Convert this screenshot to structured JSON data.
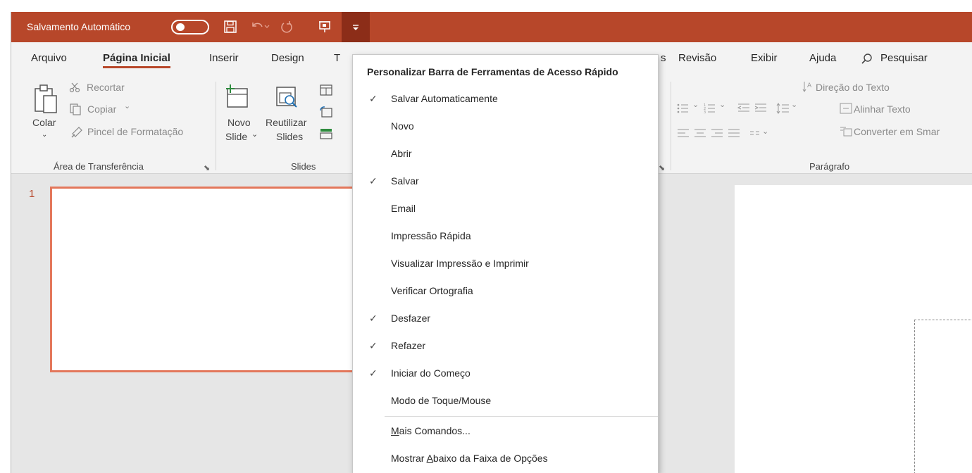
{
  "colors": {
    "brand": "#b7472a",
    "brand_dark": "#8c2d18",
    "thumb_border": "#e3775b"
  },
  "titlebar": {
    "autosave_label": "Salvamento Automático",
    "icons": [
      "toggle-off",
      "save-icon",
      "undo-icon",
      "redo-icon",
      "start-from-beginning-icon",
      "customize-qat-icon"
    ]
  },
  "tabs": [
    "Arquivo",
    "Página Inicial",
    "Inserir",
    "Design",
    "T",
    "s",
    "Revisão",
    "Exibir",
    "Ajuda",
    "Pesquisar"
  ],
  "ribbon": {
    "clipboard": {
      "paste": "Colar",
      "cut": "Recortar",
      "copy": "Copiar",
      "format_painter": "Pincel de Formatação",
      "group_label": "Área de Transferência"
    },
    "slides": {
      "new_slide_1": "Novo",
      "new_slide_2": "Slide",
      "reuse_1": "Reutilizar",
      "reuse_2": "Slides",
      "group_label": "Slides"
    },
    "paragraph": {
      "text_direction": "Direção do Texto",
      "align_text": "Alinhar Texto",
      "convert_smartart": "Converter em Smar",
      "group_label": "Parágrafo"
    }
  },
  "slide_pane": {
    "slide_number": "1"
  },
  "qat_menu": {
    "title": "Personalizar Barra de Ferramentas de Acesso Rápido",
    "items": [
      {
        "label": "Salvar Automaticamente",
        "checked": true
      },
      {
        "label": "Novo",
        "checked": false
      },
      {
        "label": "Abrir",
        "checked": false
      },
      {
        "label": "Salvar",
        "checked": true
      },
      {
        "label": "Email",
        "checked": false
      },
      {
        "label": "Impressão Rápida",
        "checked": false
      },
      {
        "label": "Visualizar Impressão e Imprimir",
        "checked": false
      },
      {
        "label": "Verificar Ortografia",
        "checked": false
      },
      {
        "label": "Desfazer",
        "checked": true
      },
      {
        "label": "Refazer",
        "checked": true
      },
      {
        "label": "Iniciar do Começo",
        "checked": true
      },
      {
        "label": "Modo de Toque/Mouse",
        "checked": false
      }
    ],
    "more_commands_pre": "",
    "more_commands_ul": "M",
    "more_commands_post": "ais Comandos...",
    "show_below_pre": "Mostrar ",
    "show_below_ul": "A",
    "show_below_post": "baixo da Faixa de Opções",
    "check_glyph": "✓"
  }
}
